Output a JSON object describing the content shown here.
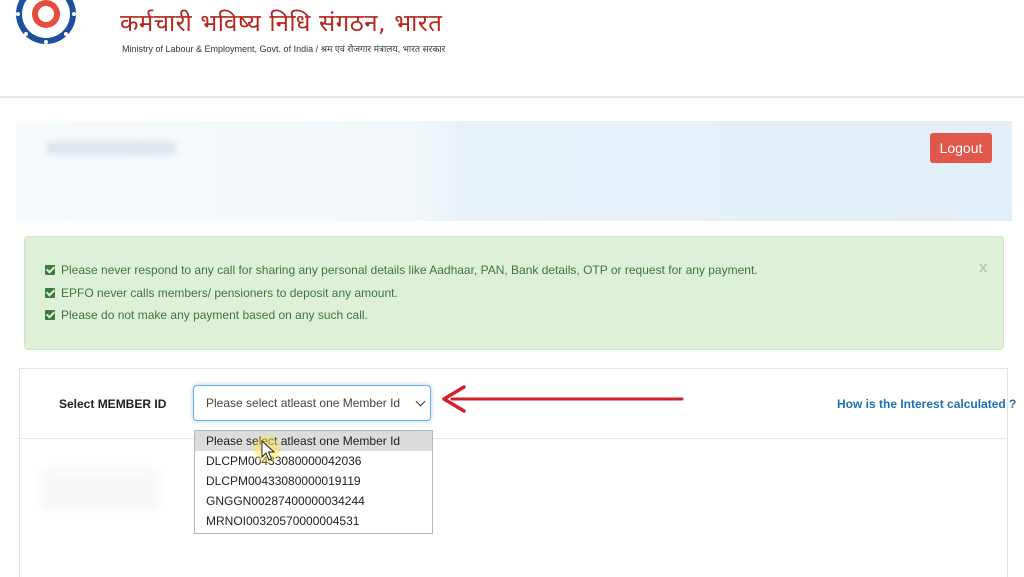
{
  "header": {
    "org_title": "कर्मचारी भविष्य निधि संगठन, भारत",
    "org_subtitle": "Ministry of Labour & Employment, Govt. of India / श्रम एवं रोजगार मंत्रालय, भारत सरकार",
    "logo_icon": "epfo-emblem-icon"
  },
  "top_panel": {
    "logout_label": "Logout"
  },
  "alert": {
    "lines": [
      "Please never respond to any call for sharing any personal details like Aadhaar, PAN, Bank details, OTP or request for any payment.",
      "EPFO never calls members/ pensioners to deposit any amount.",
      "Please do not make any payment based on any such call."
    ],
    "close_label": "x",
    "colors": {
      "background": "#dff0d8",
      "text": "#3c763d"
    }
  },
  "member": {
    "label": "Select MEMBER ID",
    "selected": "Please select atleast one Member Id",
    "options": [
      "Please select atleast one Member Id",
      "DLCPM00433080000042036",
      "DLCPM00433080000019119",
      "GNGGN00287400000034244",
      "MRNOI00320570000004531"
    ]
  },
  "interest_link": "How is the Interest calculated ?",
  "colors": {
    "brand_red": "#b3261e",
    "logout_bg": "#e2574c",
    "link": "#1f6fb2",
    "annotation_arrow": "#d0212b"
  }
}
